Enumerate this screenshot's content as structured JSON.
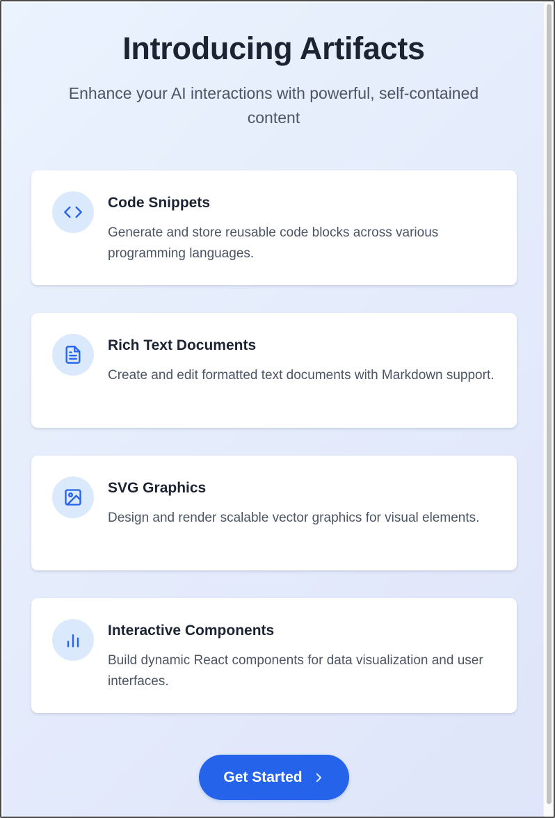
{
  "header": {
    "title": "Introducing Artifacts",
    "subtitle": "Enhance your AI interactions with powerful, self-contained content"
  },
  "features": [
    {
      "title": "Code Snippets",
      "description": "Generate and store reusable code blocks across various programming languages.",
      "icon": "code-icon"
    },
    {
      "title": "Rich Text Documents",
      "description": "Create and edit formatted text documents with Markdown support.",
      "icon": "document-icon"
    },
    {
      "title": "SVG Graphics",
      "description": "Design and render scalable vector graphics for visual elements.",
      "icon": "image-icon"
    },
    {
      "title": "Interactive Components",
      "description": "Build dynamic React components for data visualization and user interfaces.",
      "icon": "bar-chart-icon"
    }
  ],
  "cta": {
    "label": "Get Started",
    "icon": "chevron-right-icon"
  },
  "colors": {
    "accent": "#2563eb",
    "icon_bg": "#dbe9fd",
    "title_text": "#1c2434",
    "body_text": "#4b5563"
  }
}
